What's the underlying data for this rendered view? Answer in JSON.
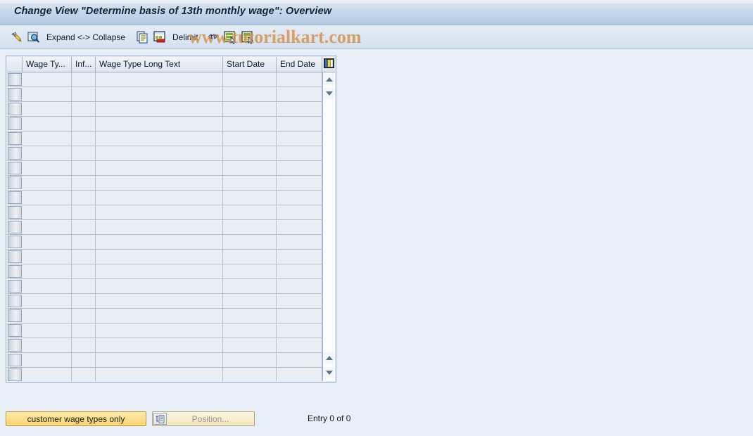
{
  "window": {
    "title": "Change View \"Determine basis of 13th monthly wage\": Overview"
  },
  "watermark": {
    "text": "www.tutorialkart.com",
    "color": "#d98f43"
  },
  "toolbar": {
    "items": [
      {
        "type": "icon",
        "name": "change-display-pencil-icon",
        "label": ""
      },
      {
        "type": "icon",
        "name": "display-magnifier-icon",
        "label": ""
      },
      {
        "type": "text",
        "name": "expand-collapse-button",
        "label": "Expand <-> Collapse"
      },
      {
        "type": "icon",
        "name": "copy-as-icon",
        "label": ""
      },
      {
        "type": "icon",
        "name": "delete-row-icon",
        "label": ""
      },
      {
        "type": "text",
        "name": "delimit-button",
        "label": "Delimit"
      },
      {
        "type": "icon",
        "name": "undo-delimit-icon",
        "label": ""
      },
      {
        "type": "icon",
        "name": "select-block-icon",
        "label": ""
      },
      {
        "type": "icon",
        "name": "select-all-icon",
        "label": ""
      }
    ]
  },
  "table": {
    "columns": [
      {
        "key": "wage_type",
        "label": "Wage Ty..."
      },
      {
        "key": "infotype",
        "label": "Inf..."
      },
      {
        "key": "long_text",
        "label": "Wage Type Long Text"
      },
      {
        "key": "start_date",
        "label": "Start Date"
      },
      {
        "key": "end_date",
        "label": "End Date"
      }
    ],
    "settings_icon": "table-settings-icon",
    "rows": [],
    "empty_row_count": 21,
    "scroll": {
      "top_up": "scroll-up-icon",
      "top_down": "scroll-down-icon",
      "bottom_up": "scroll-page-up-icon",
      "bottom_down": "scroll-page-down-icon"
    }
  },
  "footer": {
    "customer_wage_types_label": "customer wage types only",
    "position_label": "Position...",
    "position_icon": "position-list-icon",
    "entry_count": "Entry 0 of 0"
  },
  "colors": {
    "background": "#e9eef5",
    "title_bar": "#c3d5e8",
    "accent_yellow": "#fbdf8a",
    "grid_line": "#aebdd0"
  }
}
